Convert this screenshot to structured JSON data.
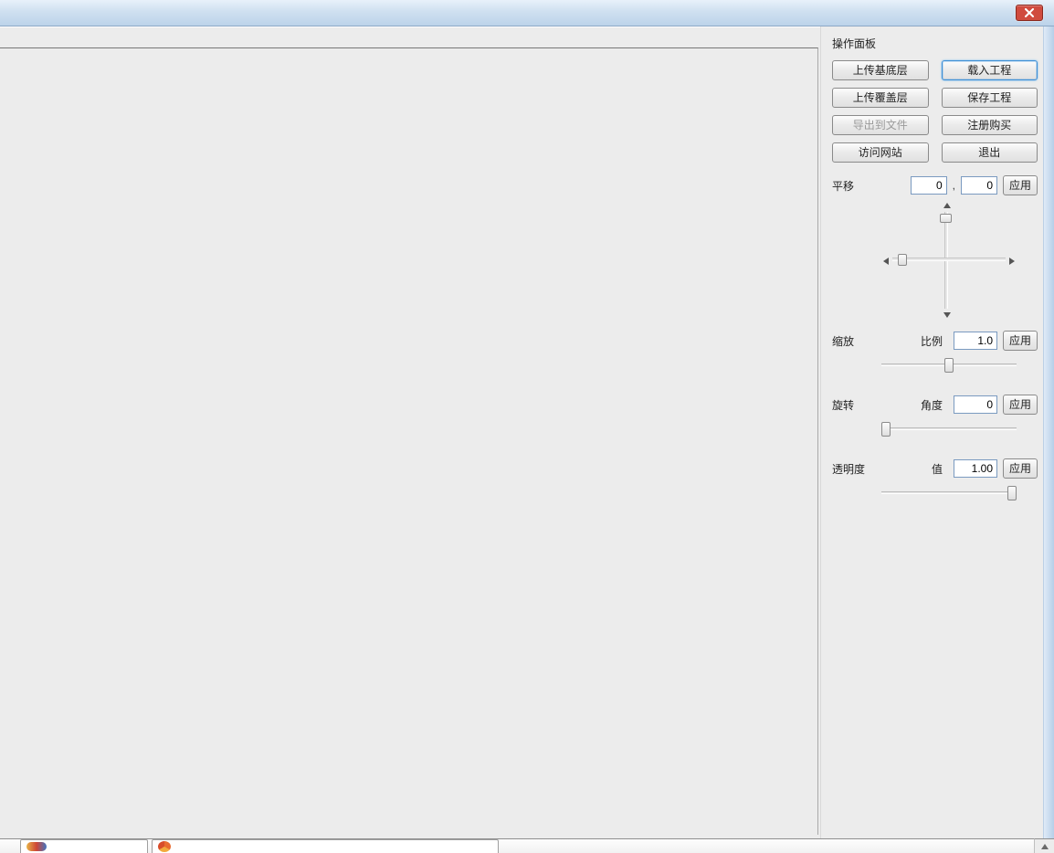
{
  "panel": {
    "title": "操作面板",
    "buttons": {
      "upload_base": "上传基底层",
      "load_project": "载入工程",
      "upload_overlay": "上传覆盖层",
      "save_project": "保存工程",
      "export_file": "导出到文件",
      "register_buy": "注册购买",
      "visit_site": "访问网站",
      "exit": "退出"
    },
    "pan": {
      "label": "平移",
      "x": "0",
      "y": "0",
      "apply": "应用",
      "separator": ","
    },
    "scale": {
      "label": "缩放",
      "sub_label": "比例",
      "value": "1.0",
      "apply": "应用",
      "thumb_pct": 50
    },
    "rotate": {
      "label": "旋转",
      "sub_label": "角度",
      "value": "0",
      "apply": "应用",
      "thumb_pct": 0
    },
    "opacity": {
      "label": "透明度",
      "sub_label": "值",
      "value": "1.00",
      "apply": "应用",
      "thumb_pct": 100
    }
  }
}
